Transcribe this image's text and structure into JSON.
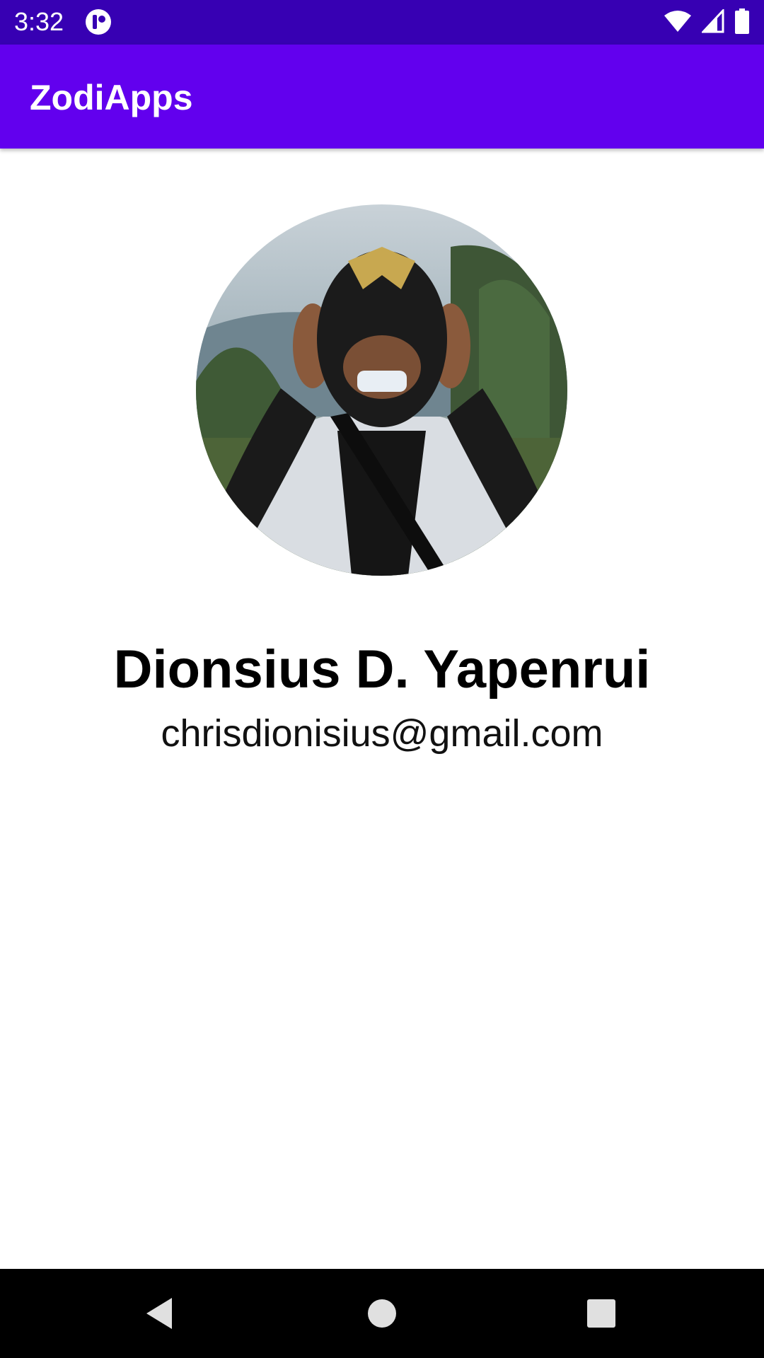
{
  "status_bar": {
    "time": "3:32",
    "background": "#3700b3",
    "icons": [
      "app-notification-icon",
      "wifi-icon",
      "cellular-signal-icon",
      "battery-icon"
    ]
  },
  "app_bar": {
    "title": "ZodiApps",
    "background": "#6200ee"
  },
  "profile": {
    "avatar_icon": "profile-photo",
    "name": "Dionsius D. Yapenrui",
    "email": "chrisdionisius@gmail.com"
  },
  "nav_bar": {
    "background": "#000000",
    "buttons": [
      "back-icon",
      "home-icon",
      "recents-icon"
    ]
  }
}
